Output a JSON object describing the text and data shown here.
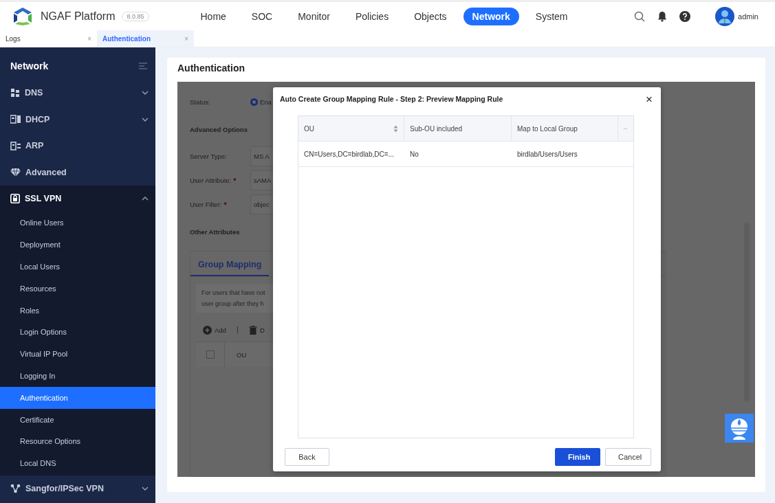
{
  "header": {
    "product": "NGAF Platform",
    "version": "8.0.85",
    "nav": [
      {
        "label": "Home",
        "selected": false
      },
      {
        "label": "SOC",
        "selected": false
      },
      {
        "label": "Monitor",
        "selected": false
      },
      {
        "label": "Policies",
        "selected": false
      },
      {
        "label": "Objects",
        "selected": false
      },
      {
        "label": "Network",
        "selected": true
      },
      {
        "label": "System",
        "selected": false
      }
    ],
    "user": "admin"
  },
  "tabs": [
    {
      "label": "Logs",
      "selected": false,
      "close": "×"
    },
    {
      "label": "Authentication",
      "selected": true,
      "close": "×"
    }
  ],
  "sidebar": {
    "title": "Network",
    "items": [
      {
        "label": "DNS",
        "kind": "group",
        "expanded": false
      },
      {
        "label": "DHCP",
        "kind": "group",
        "expanded": false
      },
      {
        "label": "ARP",
        "kind": "link"
      },
      {
        "label": "Advanced",
        "kind": "link"
      },
      {
        "label": "SSL VPN",
        "kind": "group",
        "expanded": true,
        "children": [
          {
            "label": "Online Users",
            "selected": false
          },
          {
            "label": "Deployment",
            "selected": false
          },
          {
            "label": "Local Users",
            "selected": false
          },
          {
            "label": "Resources",
            "selected": false
          },
          {
            "label": "Roles",
            "selected": false
          },
          {
            "label": "Login Options",
            "selected": false
          },
          {
            "label": "Virtual IP Pool",
            "selected": false
          },
          {
            "label": "Logging In",
            "selected": false
          },
          {
            "label": "Authentication",
            "selected": true
          },
          {
            "label": "Certificate",
            "selected": false
          },
          {
            "label": "Resource Options",
            "selected": false
          },
          {
            "label": "Local DNS",
            "selected": false
          }
        ]
      },
      {
        "label": "Sangfor/IPSec VPN",
        "kind": "group",
        "expanded": false
      }
    ]
  },
  "page": {
    "title": "Authentication",
    "form": {
      "status_label": "Status:",
      "status_options": [
        {
          "label": "Ena",
          "selected": true
        }
      ],
      "advanced_heading": "Advanced Options",
      "fields": [
        {
          "label": "Server Type:",
          "value": "MS A"
        },
        {
          "label": "User Attribute:",
          "required_mark": "*",
          "value": "sAMA"
        },
        {
          "label": "User Filter:",
          "required_mark": "*",
          "value": "objec"
        }
      ],
      "other_heading": "Other Attributes",
      "group_mapping": {
        "tab": "Group Mapping",
        "info": [
          "For users that have not",
          "user group after they h"
        ],
        "toolbar": [
          {
            "label": "Add"
          },
          {
            "label": "D"
          }
        ],
        "header_checked": false,
        "column": "OU"
      }
    }
  },
  "dialog": {
    "title": "Auto Create Group Mapping Rule - Step 2: Preview Mapping Rule",
    "close": "×",
    "columns": [
      {
        "label": "OU",
        "sortable": true
      },
      {
        "label": "Sub-OU included",
        "sortable": false
      },
      {
        "label": "Map to Local Group",
        "sortable": false
      }
    ],
    "rows": [
      [
        "CN=Users,DC=birdlab,DC=...",
        "No",
        "birdlab/Users/Users"
      ]
    ],
    "back": "Back",
    "finish": "Finish",
    "cancel": "Cancel"
  }
}
